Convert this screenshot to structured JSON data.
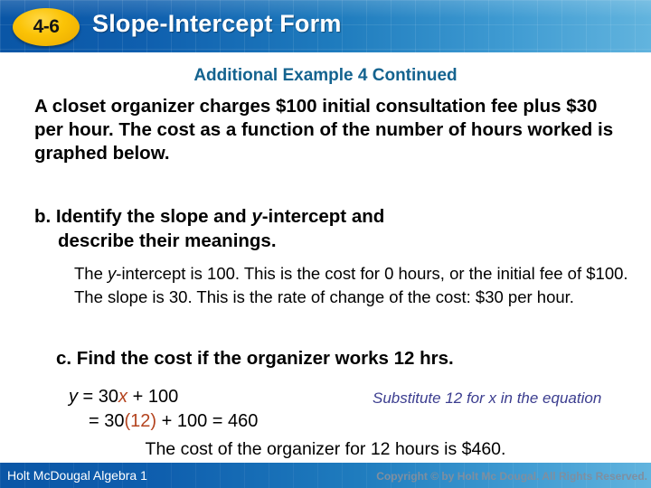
{
  "header": {
    "badge": "4-6",
    "title": "Slope-Intercept Form",
    "bg_color_left": "#0a56a6",
    "bg_color_right": "#62b4de",
    "badge_color": "#fbc306"
  },
  "main": {
    "subtitle": "Additional Example 4 Continued",
    "subtitle_color": "#14638f",
    "problem_text": "A closet organizer charges $100 initial consultation fee plus $30 per hour. The cost as a function of the number of hours worked is graphed below.",
    "part_b": {
      "line1_pre": "b. Identify the slope and ",
      "line1_italic": "y",
      "line1_post": "-intercept and",
      "line2": "describe their meanings."
    },
    "answer_b": {
      "pre": "The ",
      "italic": "y",
      "post": "-intercept is 100. This is the cost for 0 hours, or the initial fee of $100. The slope is 30. This is the rate of change of the cost: $30 per hour."
    },
    "part_c": "c. Find the cost if the organizer works 12 hrs.",
    "equation": {
      "line1_y": "y",
      "line1_a": " = 30",
      "line1_x": "x",
      "line1_b": " + 100",
      "line2_a": "= 30",
      "line2_paren": "(12)",
      "line2_b": " + 100 = 460",
      "highlight_color": "#b4441f"
    },
    "note": "Substitute 12 for x in the equation",
    "note_color": "#3b3d8f",
    "final_line": "The cost of the organizer for 12 hours is $460."
  },
  "footer": {
    "left": "Holt McDougal Algebra 1",
    "right": "Copyright © by Holt Mc Dougal. All Rights Reserved."
  }
}
